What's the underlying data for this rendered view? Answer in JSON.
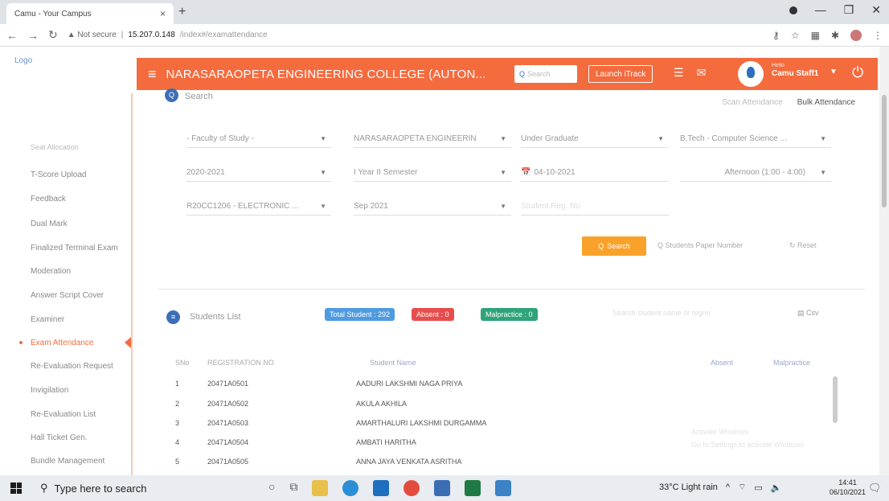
{
  "browser": {
    "tab_title": "Camu - Your Campus",
    "tab_close": "×",
    "new_tab": "+",
    "url_warning": "▲ Not secure",
    "url_host": "15.207.0.148",
    "url_path": "/index#/examattendance"
  },
  "app": {
    "logo_alt": "Logo",
    "college_name": "NARASARAOPETA ENGINEERING COLLEGE (AUTON...",
    "search_placeholder": "Search",
    "launch_label": "Launch iTrack",
    "user_greeting": "Hello",
    "user_name": "Camu Staff1"
  },
  "sidebar": {
    "items": [
      {
        "label": "Seat Allocation"
      },
      {
        "label": "T-Score Upload"
      },
      {
        "label": "Feedback"
      },
      {
        "label": "Dual Mark"
      },
      {
        "label": "Finalized Terminal Exam"
      },
      {
        "label": "Moderation"
      },
      {
        "label": "Answer Script Cover"
      },
      {
        "label": "Examiner"
      },
      {
        "label": "Exam Attendance"
      },
      {
        "label": "Re-Evaluation Request"
      },
      {
        "label": "Invigilation"
      },
      {
        "label": "Re-Evaluation List"
      },
      {
        "label": "Hall Ticket Gen."
      },
      {
        "label": "Bundle Management"
      }
    ]
  },
  "search_panel": {
    "title": "Search",
    "scan_tab": "Scan Attendance",
    "bulk_tab": "Bulk Attendance",
    "fields": {
      "faculty": "- Faculty of Study -",
      "institution": "NARASARAOPETA ENGINEERIN",
      "program_level": "Under Graduate",
      "program": "B.Tech - Computer Science ...",
      "academic_year": "2020-2021",
      "semester": "I Year II Semester",
      "exam_date": "04-10-2021",
      "session": "Afternoon (1:00 - 4:00)",
      "course": "R20CC1206 - ELECTRONIC ...",
      "exam_month": "Sep 2021",
      "student_reg_placeholder": "Student Reg. No"
    },
    "search_button": "Search",
    "scan_paper_button": "Students Paper Number",
    "reset_button": "Reset"
  },
  "students_list": {
    "title": "Students List",
    "badge_total": "Total Student : 292",
    "badge_absent": "Absent : 0",
    "badge_malpractice": "Malpractice : 0",
    "search_placeholder": "Search student name or regno",
    "csv_label": "Csv",
    "columns": {
      "sno": "SNo",
      "reg": "REGISTRATION NO",
      "name": "Student Name",
      "absent": "Absent",
      "malpractice": "Malpractice"
    },
    "rows": [
      {
        "sno": "1",
        "reg": "20471A0501",
        "name": "AADURI LAKSHMI NAGA PRIYA"
      },
      {
        "sno": "2",
        "reg": "20471A0502",
        "name": "AKULA AKHILA"
      },
      {
        "sno": "3",
        "reg": "20471A0503",
        "name": "AMARTHALURI LAKSHMI DURGAMMA"
      },
      {
        "sno": "4",
        "reg": "20471A0504",
        "name": "AMBATI HARITHA"
      },
      {
        "sno": "5",
        "reg": "20471A0505",
        "name": "ANNA JAYA VENKATA ASRITHA"
      }
    ],
    "side_note_1": "Activate Windows",
    "side_note_2": "Go to Settings to activate Windows."
  },
  "taskbar": {
    "search_text": "Type here to search",
    "weather": "33°C  Light rain",
    "time": "14:41",
    "date": "06/10/2021"
  }
}
